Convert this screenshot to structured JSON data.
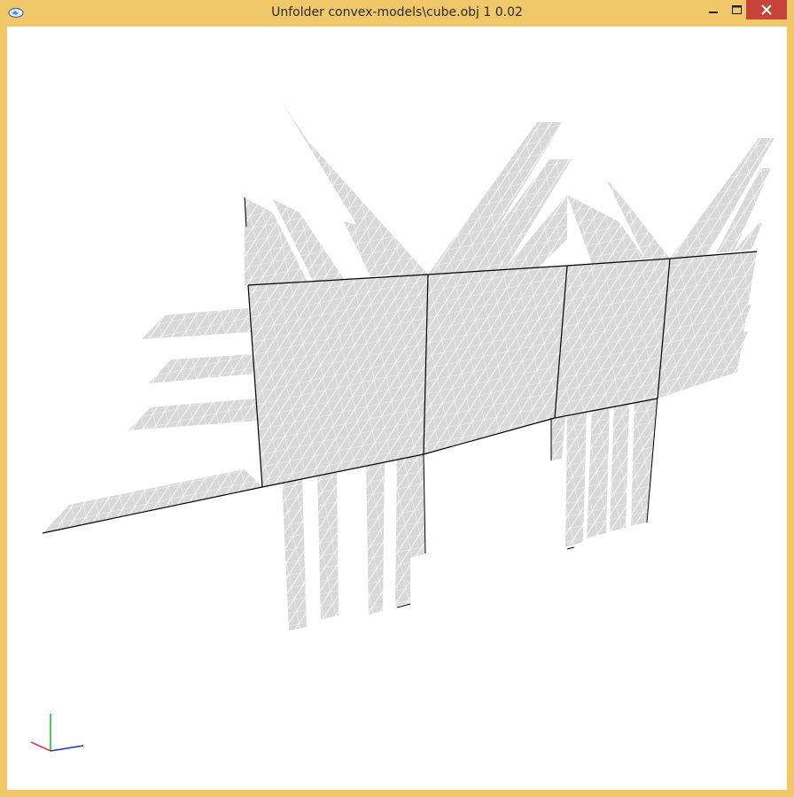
{
  "window": {
    "title": "Unfolder convex-models\\cube.obj 1 0.02",
    "app_icon": "app-logo-icon",
    "buttons": {
      "minimize": "minimize-icon",
      "maximize": "maximize-icon",
      "close": "close-icon"
    }
  },
  "viewport": {
    "background": "#ffffff",
    "mesh_fill": "#d7d7d7",
    "mesh_line": "#ffffff",
    "edge_line": "#000000",
    "axis_colors": {
      "x": "#1f2fd0",
      "y": "#19b81d",
      "z": "#d52424"
    }
  }
}
